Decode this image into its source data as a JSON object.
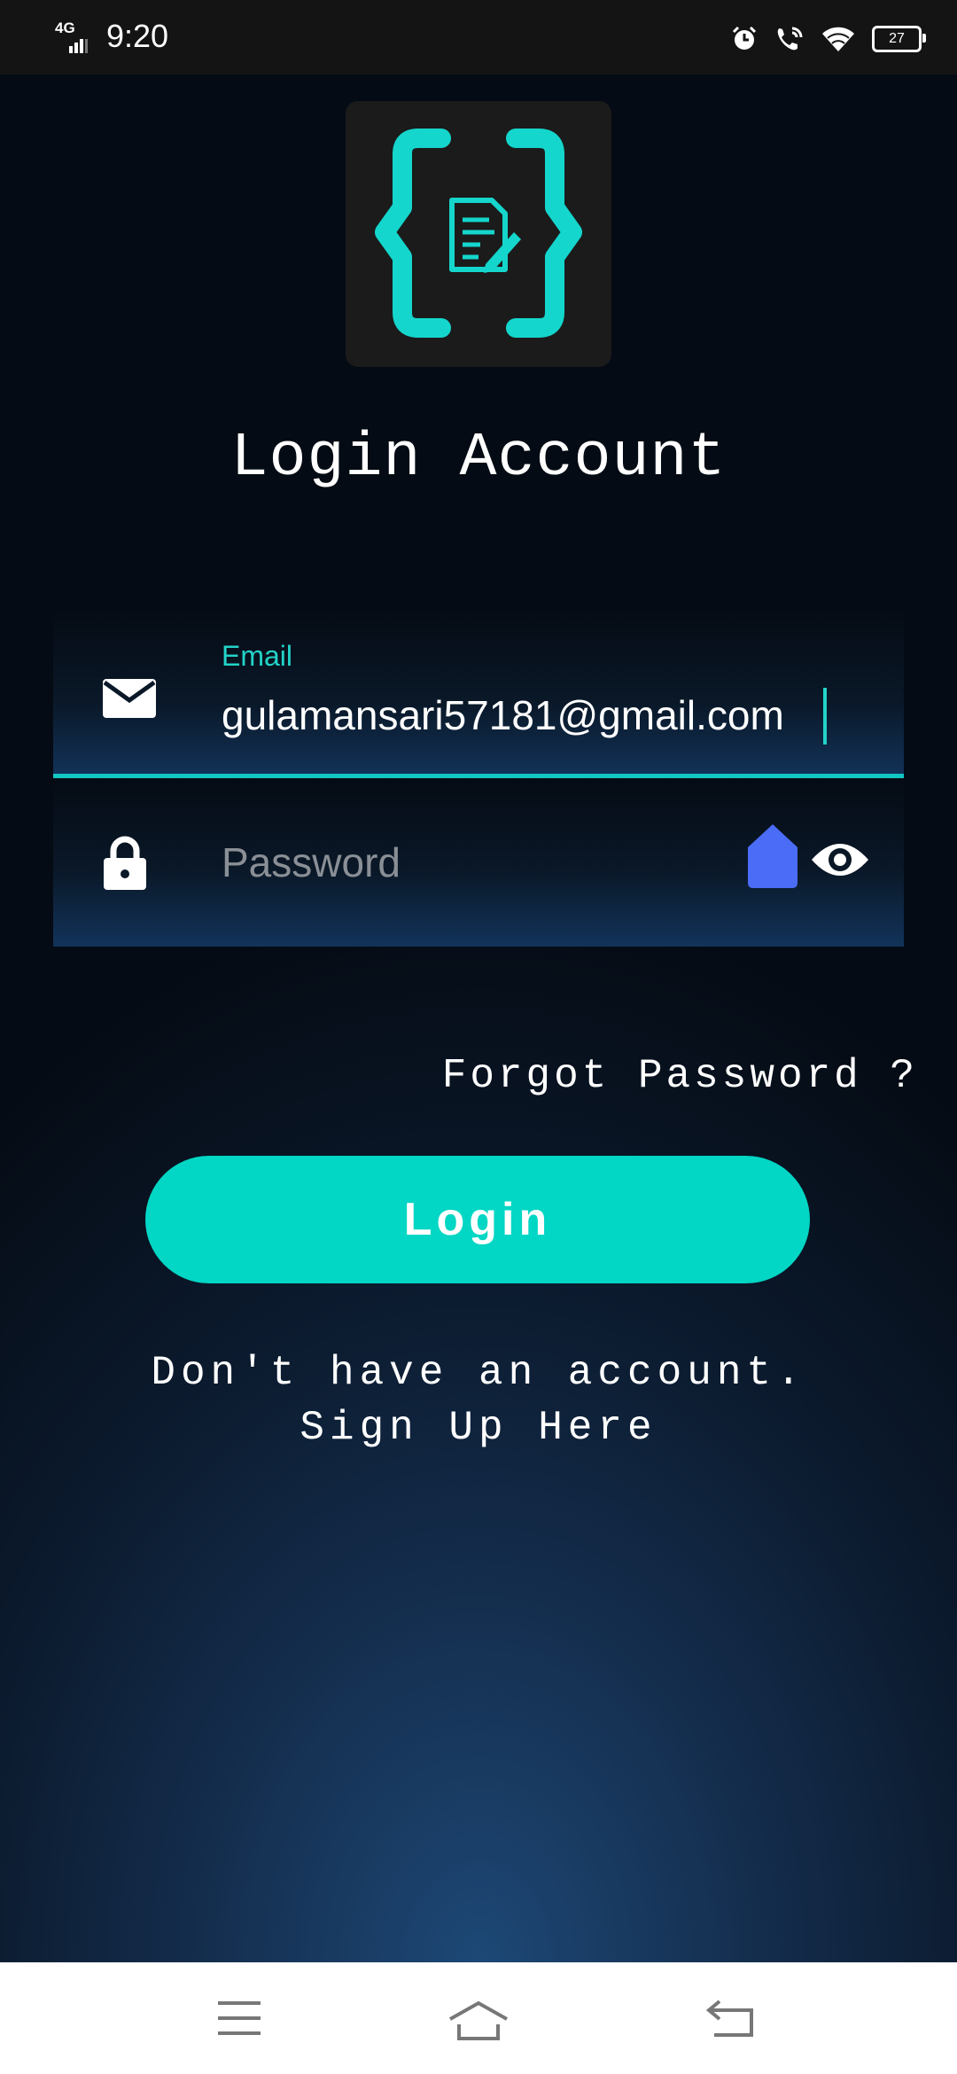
{
  "status_bar": {
    "network": "4G",
    "time": "9:20",
    "battery": "27"
  },
  "login": {
    "title": "Login Account",
    "email_label": "Email",
    "email_value": "gulamansari57181@gmail.com",
    "password_placeholder": "Password",
    "forgot_password": "Forgot Password ?",
    "login_button": "Login",
    "signup_line1": "Don't have an account.",
    "signup_line2": "Sign Up Here"
  },
  "colors": {
    "accent": "#02d6c4",
    "handle": "#4a6cf7",
    "logo_bg": "#1b1b1b"
  },
  "icons": [
    "signal-icon",
    "alarm-icon",
    "wifi-call-icon",
    "wifi-icon",
    "battery-icon",
    "app-logo-icon",
    "mail-icon",
    "lock-icon",
    "eye-icon",
    "menu-icon",
    "home-icon",
    "back-icon"
  ]
}
